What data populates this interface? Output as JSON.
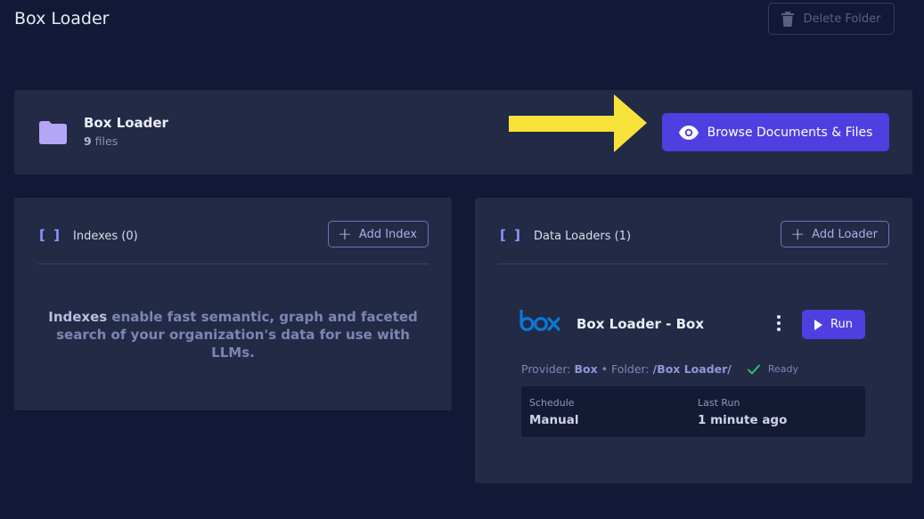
{
  "header": {
    "title": "Box Loader",
    "delete_label": "Delete Folder"
  },
  "folder": {
    "name": "Box Loader",
    "count": "9",
    "count_suffix": " files",
    "browse_label": "Browse Documents & Files"
  },
  "indexes": {
    "bracket": "[ ]",
    "title": "Indexes (0)",
    "add_label": "Add Index",
    "empty_strong": "Indexes",
    "empty_text": " enable fast semantic, graph and faceted search of your organization's data for use with LLMs."
  },
  "loaders": {
    "bracket": "[ ]",
    "title": "Data Loaders (1)",
    "add_label": "Add Loader",
    "items": [
      {
        "name": "Box Loader - Box",
        "logo_text": "box",
        "run_label": "Run",
        "provider_label": "Provider:",
        "provider": "Box",
        "separator": "•",
        "folder_label": "Folder:",
        "folder": "/Box Loader/",
        "status": "Ready",
        "schedule_label": "Schedule",
        "schedule": "Manual",
        "last_run_label": "Last Run",
        "last_run": "1 minute ago"
      }
    ]
  },
  "colors": {
    "background": "#121936",
    "panel": "#222a46",
    "primary": "#4f3ee0",
    "arrow": "#f7e23a",
    "box_brand": "#0a7ad6",
    "success": "#2ecc71"
  },
  "icons": {
    "delete": "trash-icon",
    "folder": "folder-icon",
    "browse": "eye-icon",
    "add": "plus-icon",
    "run": "play-icon",
    "menu": "kebab-menu-icon",
    "status": "check-icon"
  }
}
